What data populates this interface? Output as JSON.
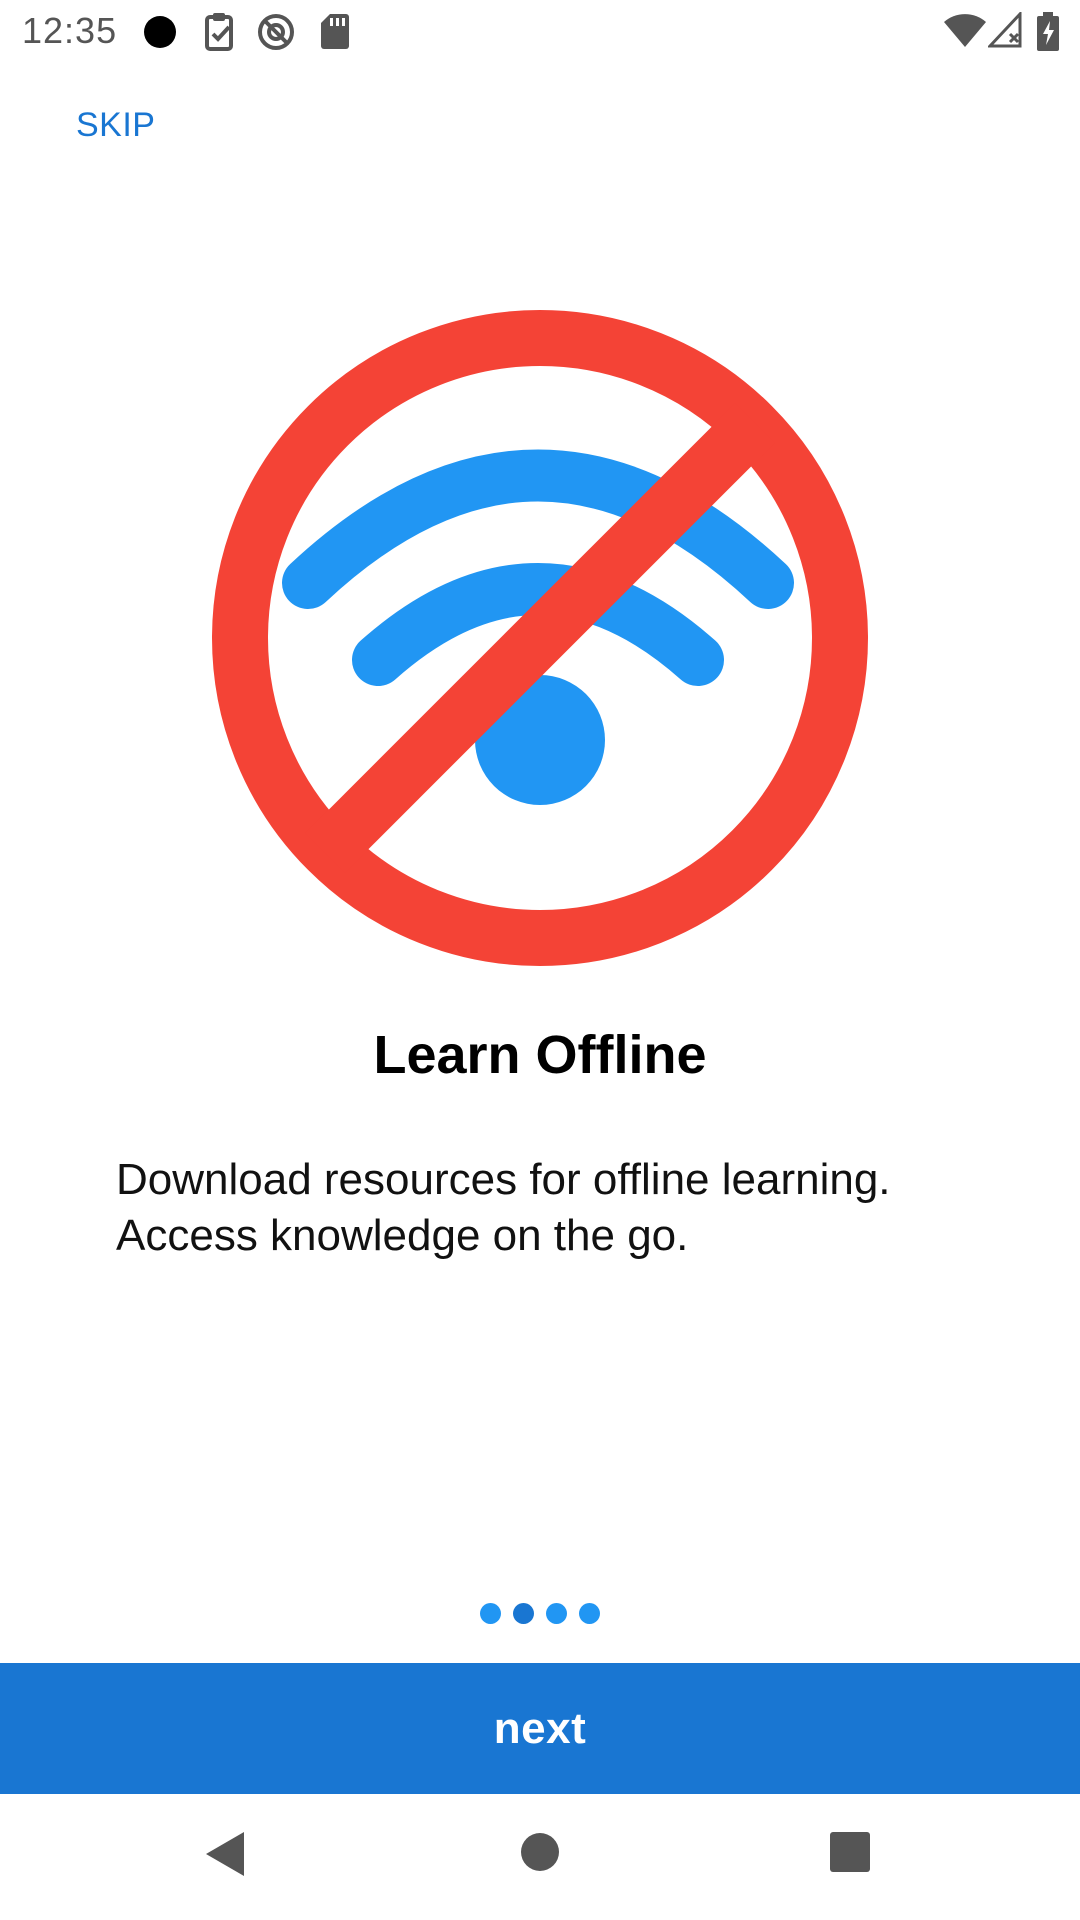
{
  "status_bar": {
    "time": "12:35",
    "icons_left": [
      "record-dot-icon",
      "clipboard-check-icon",
      "do-not-disturb-icon",
      "sd-card-icon"
    ],
    "icons_right": [
      "wifi-icon",
      "cell-signal-off-icon",
      "battery-charging-icon"
    ]
  },
  "header": {
    "skip_label": "SKIP"
  },
  "illustration": {
    "icon": "wifi-off-icon",
    "colors": {
      "prohibition": "#f44336",
      "wifi": "#2196f3"
    }
  },
  "content": {
    "title": "Learn Offline",
    "description_line1": "Download resources for offline learning.",
    "description_line2": "Access knowledge on the go."
  },
  "pager": {
    "count": 4,
    "active_index": 1
  },
  "footer": {
    "next_label": "next"
  },
  "nav_bar": {
    "buttons": [
      "back-icon",
      "home-icon",
      "recents-icon"
    ]
  },
  "colors": {
    "accent": "#1976d2",
    "dot": "#2196f3"
  }
}
